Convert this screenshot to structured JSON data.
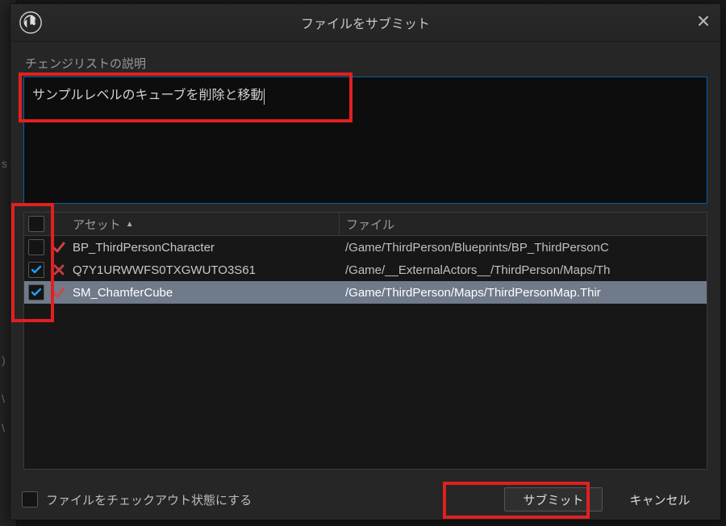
{
  "window": {
    "title": "ファイルをサブミット"
  },
  "description": {
    "label": "チェンジリストの説明",
    "value": "サンプルレベルのキューブを削除と移動"
  },
  "columns": {
    "asset": "アセット",
    "file": "ファイル"
  },
  "header_checkbox_checked": false,
  "rows": [
    {
      "checked": false,
      "status": "edit",
      "asset": "BP_ThirdPersonCharacter",
      "file": "/Game/ThirdPerson/Blueprints/BP_ThirdPersonC",
      "selected": false
    },
    {
      "checked": true,
      "status": "delete",
      "asset": "Q7Y1URWWFS0TXGWUTO3S61",
      "file": "/Game/__ExternalActors__/ThirdPerson/Maps/Th",
      "selected": false
    },
    {
      "checked": true,
      "status": "edit",
      "asset": "SM_ChamferCube",
      "file": "/Game/ThirdPerson/Maps/ThirdPersonMap.Thir",
      "selected": true
    }
  ],
  "keep_checked_out": {
    "checked": false,
    "label": "ファイルをチェックアウト状態にする"
  },
  "buttons": {
    "submit": "サブミット",
    "cancel": "キャンセル"
  }
}
